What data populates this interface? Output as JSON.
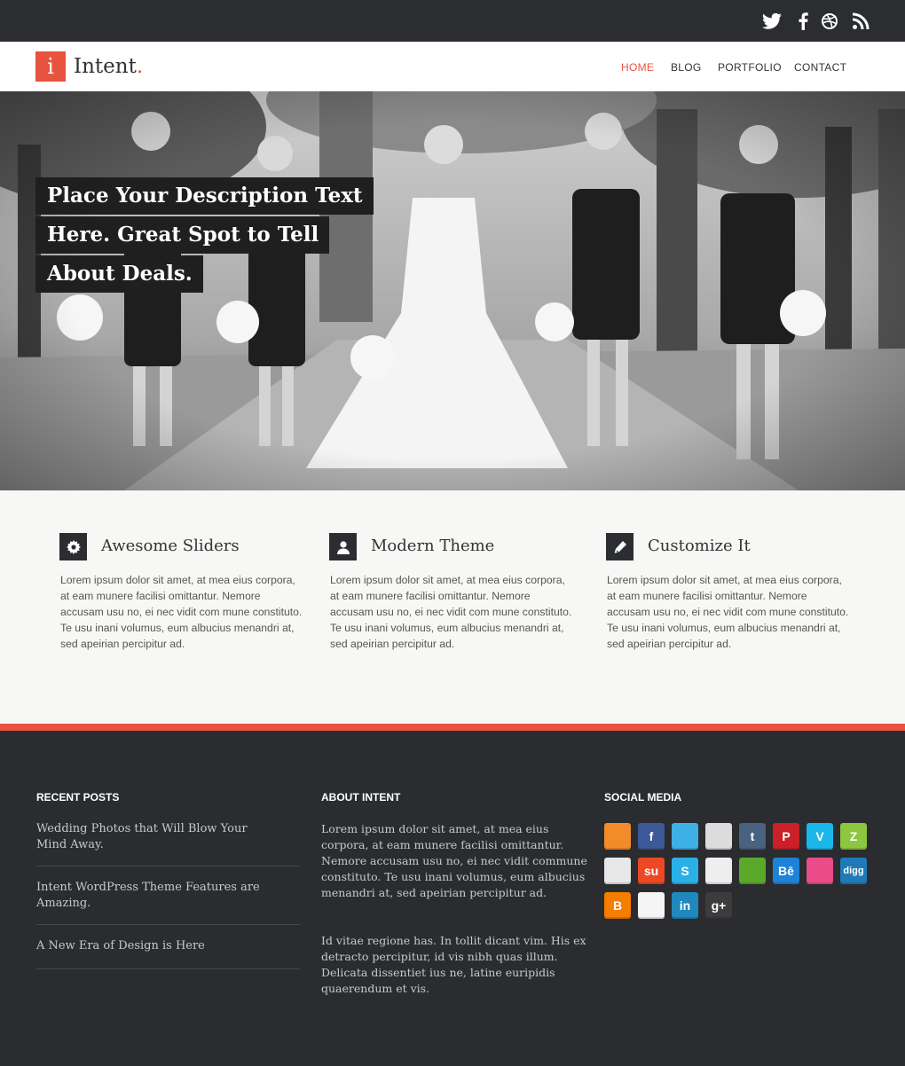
{
  "site": {
    "logo_letter": "i",
    "name": "Intent",
    "name_dot": "."
  },
  "nav": {
    "items": [
      {
        "label": "HOME",
        "active": true
      },
      {
        "label": "BLOG"
      },
      {
        "label": "PORTFOLIO"
      },
      {
        "label": "CONTACT"
      }
    ]
  },
  "hero": {
    "caption_lines": [
      "Place Your Description Text",
      "Here. Great Spot to Tell",
      "About Deals."
    ]
  },
  "features": [
    {
      "icon": "gear-icon",
      "title": "Awesome Sliders",
      "text": "Lorem ipsum dolor sit amet, at mea eius corpora, at eam munere facilisi omittantur. Nemore accusam usu no, ei nec vidit com mune constituto. Te usu inani volumus, eum albucius menandri at, sed apeirian percipitur ad."
    },
    {
      "icon": "user-icon",
      "title": "Modern Theme",
      "text": "Lorem ipsum dolor sit amet, at mea eius corpora, at eam munere facilisi omittantur. Nemore accusam usu no, ei nec vidit com mune constituto. Te usu inani volumus, eum albucius menandri at, sed apeirian percipitur ad."
    },
    {
      "icon": "pencil-icon",
      "title": "Customize It",
      "text": "Lorem ipsum dolor sit amet, at mea eius corpora, at eam munere facilisi omittantur. Nemore accusam usu no, ei nec vidit com mune constituto. Te usu inani volumus, eum albucius menandri at, sed apeirian percipitur ad."
    }
  ],
  "footer": {
    "recent_posts": {
      "heading": "RECENT POSTS",
      "items": [
        "Wedding Photos that Will Blow Your Mind Away.",
        "Intent WordPress Theme Features are Amazing.",
        "A New Era of Design is Here"
      ]
    },
    "about": {
      "heading": "ABOUT INTENT",
      "paragraphs": [
        "Lorem ipsum dolor sit amet, at mea eius corpora, at eam munere facilisi omittantur. Nemore accusam usu no, ei nec vidit commune constituto. Te usu inani volumus, eum albucius menandri at, sed apeirian percipitur ad.",
        "Id vitae regione has. In tollit dicant vim. His ex detracto percipitur, id vis nibh quas illum. Delicata dissentiet ius ne, latine euripidis quaerendum et vis."
      ]
    },
    "social": {
      "heading": "SOCIAL MEDIA",
      "icons": [
        {
          "name": "rss-icon",
          "glyph": "",
          "color": "#f28c2b"
        },
        {
          "name": "facebook-icon",
          "glyph": "f",
          "color": "#3b5998"
        },
        {
          "name": "twitter-icon",
          "glyph": "",
          "color": "#3fb0e6"
        },
        {
          "name": "email-icon",
          "glyph": "",
          "color": "#dcdcdc"
        },
        {
          "name": "tumblr-icon",
          "glyph": "t",
          "color": "#4a6282"
        },
        {
          "name": "pinterest-icon",
          "glyph": "P",
          "color": "#cb2027"
        },
        {
          "name": "vimeo-icon",
          "glyph": "V",
          "color": "#1ab7ea"
        },
        {
          "name": "zerply-icon",
          "glyph": "Z",
          "color": "#8dc63f"
        },
        {
          "name": "picasa-icon",
          "glyph": "",
          "color": "#e8e8e8"
        },
        {
          "name": "stumbleupon-icon",
          "glyph": "su",
          "color": "#eb4924"
        },
        {
          "name": "skype-icon",
          "glyph": "S",
          "color": "#2ab0e8"
        },
        {
          "name": "reddit-icon",
          "glyph": "",
          "color": "#eeeeee"
        },
        {
          "name": "evernote-icon",
          "glyph": "",
          "color": "#5aa92b"
        },
        {
          "name": "behance-icon",
          "glyph": "Bē",
          "color": "#1e82d6"
        },
        {
          "name": "dribbble-icon",
          "glyph": "",
          "color": "#ea4c89"
        },
        {
          "name": "digg-icon",
          "glyph": "digg",
          "color": "#1f7ab8"
        },
        {
          "name": "blogger-icon",
          "glyph": "B",
          "color": "#f57d00"
        },
        {
          "name": "flickr-icon",
          "glyph": "",
          "color": "#f5f5f5"
        },
        {
          "name": "linkedin-icon",
          "glyph": "in",
          "color": "#1f88be"
        },
        {
          "name": "google-plus-icon",
          "glyph": "g+",
          "color": "#3c3c3c"
        }
      ]
    }
  },
  "colors": {
    "accent": "#e8533f",
    "dark": "#2a2c2f"
  }
}
